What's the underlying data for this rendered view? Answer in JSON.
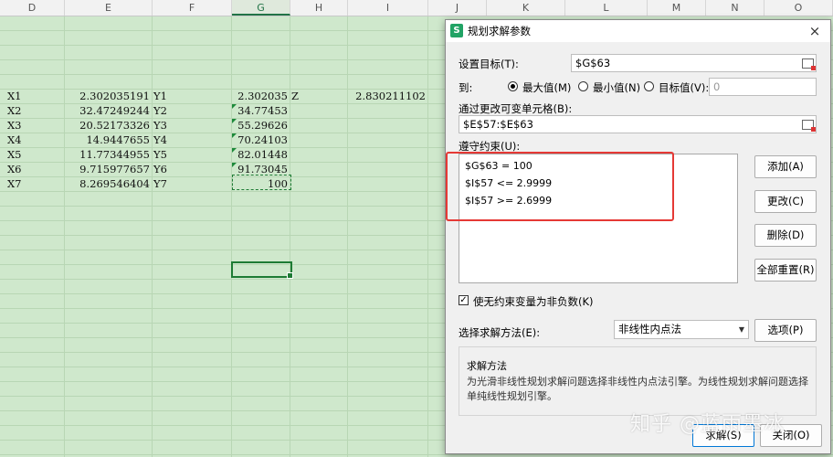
{
  "sheet": {
    "columns": [
      "D",
      "E",
      "F",
      "G",
      "H",
      "I",
      "J",
      "K",
      "L",
      "M",
      "N",
      "O"
    ],
    "active_column": "G",
    "rows": [
      {
        "d": "X1",
        "e": "2.302035191",
        "f": "Y1",
        "g": "2.302035",
        "h": "Z",
        "i": "2.830211102"
      },
      {
        "d": "X2",
        "e": "32.47249244",
        "f": "Y2",
        "g": "34.77453",
        "h": "",
        "i": ""
      },
      {
        "d": "X3",
        "e": "20.52173326",
        "f": "Y3",
        "g": "55.29626",
        "h": "",
        "i": ""
      },
      {
        "d": "X4",
        "e": "14.9447655",
        "f": "Y4",
        "g": "70.24103",
        "h": "",
        "i": ""
      },
      {
        "d": "X5",
        "e": "11.77344955",
        "f": "Y5",
        "g": "82.01448",
        "h": "",
        "i": ""
      },
      {
        "d": "X6",
        "e": "9.715977657",
        "f": "Y6",
        "g": "91.73045",
        "h": "",
        "i": ""
      },
      {
        "d": "X7",
        "e": "8.269546404",
        "f": "Y7",
        "g": "100",
        "h": "",
        "i": ""
      }
    ]
  },
  "dialog": {
    "app_icon": "S",
    "title": "规划求解参数",
    "close": "×",
    "target_label": "设置目标(T):",
    "target_value": "$G$63",
    "to_label": "到:",
    "radio_max": "最大值(M)",
    "radio_min": "最小值(N)",
    "radio_value": "目标值(V):",
    "target_number": "0",
    "selected_radio": "max",
    "change_label": "通过更改可变单元格(B):",
    "change_value": "$E$57:$E$63",
    "constraints_label": "遵守约束(U):",
    "constraints": [
      "$G$63 = 100",
      "$I$57 <= 2.9999",
      "$I$57 >= 2.6999"
    ],
    "btn_add": "添加(A)",
    "btn_change": "更改(C)",
    "btn_delete": "删除(D)",
    "btn_reset": "全部重置(R)",
    "nonneg_checked": true,
    "nonneg_label": "使无约束变量为非负数(K)",
    "method_label": "选择求解方法(E):",
    "method_value": "非线性内点法",
    "btn_options": "选项(P)",
    "group_title": "求解方法",
    "group_desc": "为光滑非线性规划求解问题选择非线性内点法引擎。为线性规划求解问题选择单纯线性规划引擎。",
    "btn_solve": "求解(S)",
    "btn_close": "关闭(O)"
  },
  "watermark": "知乎 @蓝雨墨冰",
  "colors": {
    "sheet_bg": "#cfe8cc",
    "accent": "#1e7b34",
    "highlight": "#e53935"
  }
}
